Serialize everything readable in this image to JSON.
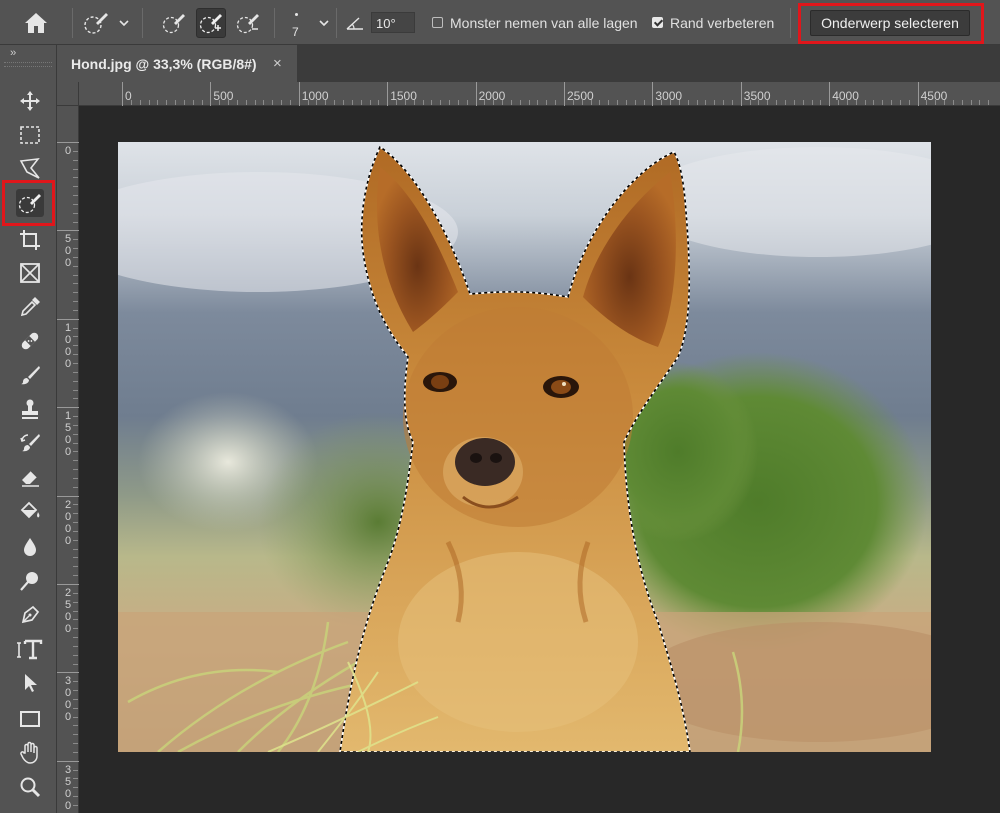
{
  "app": {
    "name": "Adobe Photoshop",
    "accent_highlight_color": "#e0161b"
  },
  "options_bar": {
    "home_icon": "home-icon",
    "brush_size_value": "7",
    "angle_value": "10°",
    "sample_all_layers": {
      "label": "Monster nemen van alle lagen",
      "checked": false
    },
    "enhance_edge": {
      "label": "Rand verbeteren",
      "checked": true
    },
    "select_subject_label": "Onderwerp selecteren"
  },
  "document_tab": {
    "title": "Hond.jpg @ 33,3% (RGB/8#)",
    "close_glyph": "×"
  },
  "toolbar": {
    "collapse_glyph": "››",
    "tools": [
      {
        "name": "move-tool",
        "icon": "move-icon"
      },
      {
        "name": "marquee-tool",
        "icon": "rectangular-marquee-icon"
      },
      {
        "name": "lasso-tool",
        "icon": "polygonal-lasso-icon"
      },
      {
        "name": "quick-selection-tool",
        "icon": "quick-selection-icon",
        "selected": true
      },
      {
        "name": "crop-tool",
        "icon": "crop-icon"
      },
      {
        "name": "frame-tool",
        "icon": "frame-icon"
      },
      {
        "name": "eyedropper-tool",
        "icon": "eyedropper-icon"
      },
      {
        "name": "healing-brush-tool",
        "icon": "bandage-icon"
      },
      {
        "name": "brush-tool",
        "icon": "brush-icon"
      },
      {
        "name": "clone-stamp-tool",
        "icon": "stamp-icon"
      },
      {
        "name": "history-brush-tool",
        "icon": "history-brush-icon"
      },
      {
        "name": "eraser-tool",
        "icon": "eraser-icon"
      },
      {
        "name": "paint-bucket-tool",
        "icon": "paint-bucket-icon"
      },
      {
        "name": "blur-tool",
        "icon": "drop-icon"
      },
      {
        "name": "dodge-tool",
        "icon": "dodge-icon"
      },
      {
        "name": "pen-tool",
        "icon": "pen-icon"
      },
      {
        "name": "type-tool",
        "icon": "type-icon"
      },
      {
        "name": "path-selection-tool",
        "icon": "arrow-icon"
      },
      {
        "name": "rectangle-tool",
        "icon": "rectangle-icon"
      },
      {
        "name": "hand-tool",
        "icon": "hand-icon"
      },
      {
        "name": "zoom-tool",
        "icon": "magnifier-icon"
      }
    ]
  },
  "rulers": {
    "horizontal_labels": [
      "0",
      "500",
      "1000",
      "1500",
      "2000",
      "2500",
      "3000",
      "3500",
      "4000",
      "4500"
    ],
    "vertical_labels": [
      "0",
      "500",
      "1000",
      "1500",
      "2000",
      "2500",
      "3000",
      "3500"
    ]
  },
  "canvas": {
    "image_subject": "dog-photo",
    "selection": "marching-ants-around-dog"
  }
}
